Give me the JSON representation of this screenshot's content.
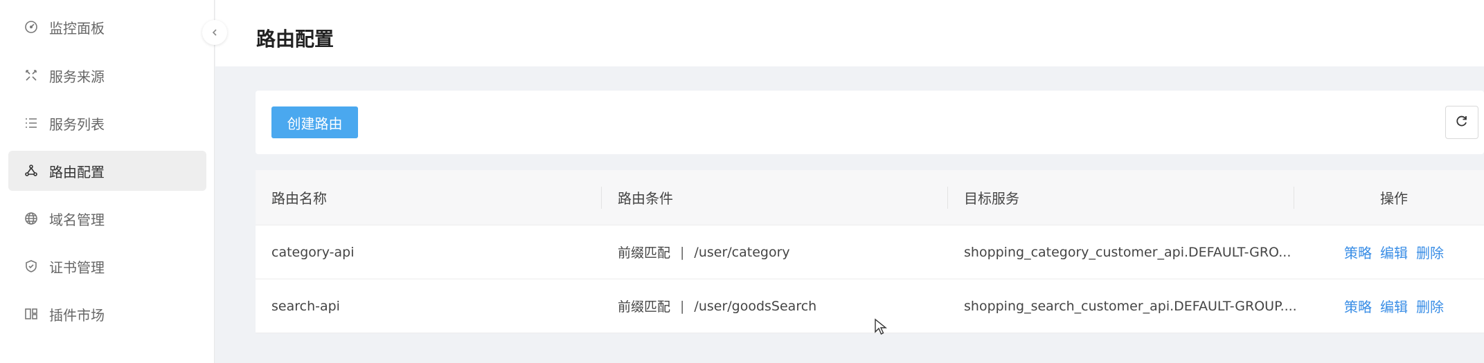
{
  "sidebar": {
    "items": [
      {
        "label": "监控面板",
        "icon": "dashboard-icon",
        "active": false
      },
      {
        "label": "服务来源",
        "icon": "service-source-icon",
        "active": false
      },
      {
        "label": "服务列表",
        "icon": "list-icon",
        "active": false
      },
      {
        "label": "路由配置",
        "icon": "route-icon",
        "active": true
      },
      {
        "label": "域名管理",
        "icon": "globe-icon",
        "active": false
      },
      {
        "label": "证书管理",
        "icon": "shield-icon",
        "active": false
      },
      {
        "label": "插件市场",
        "icon": "plugin-icon",
        "active": false
      }
    ]
  },
  "header": {
    "title": "路由配置"
  },
  "toolbar": {
    "create_label": "创建路由"
  },
  "table": {
    "columns": [
      "路由名称",
      "路由条件",
      "目标服务",
      "操作"
    ],
    "rows": [
      {
        "name": "category-api",
        "match_type": "前缀匹配",
        "separator": "|",
        "path": "/user/category",
        "target": "shopping_category_customer_api.DEFAULT-GRO...",
        "ops": [
          "策略",
          "编辑",
          "删除"
        ]
      },
      {
        "name": "search-api",
        "match_type": "前缀匹配",
        "separator": "|",
        "path": "/user/goodsSearch",
        "target": "shopping_search_customer_api.DEFAULT-GROUP....",
        "ops": [
          "策略",
          "编辑",
          "删除"
        ]
      }
    ]
  },
  "colors": {
    "primary": "#4aa8ef",
    "link": "#3a8ee6",
    "active_bg": "#eeeeee"
  }
}
